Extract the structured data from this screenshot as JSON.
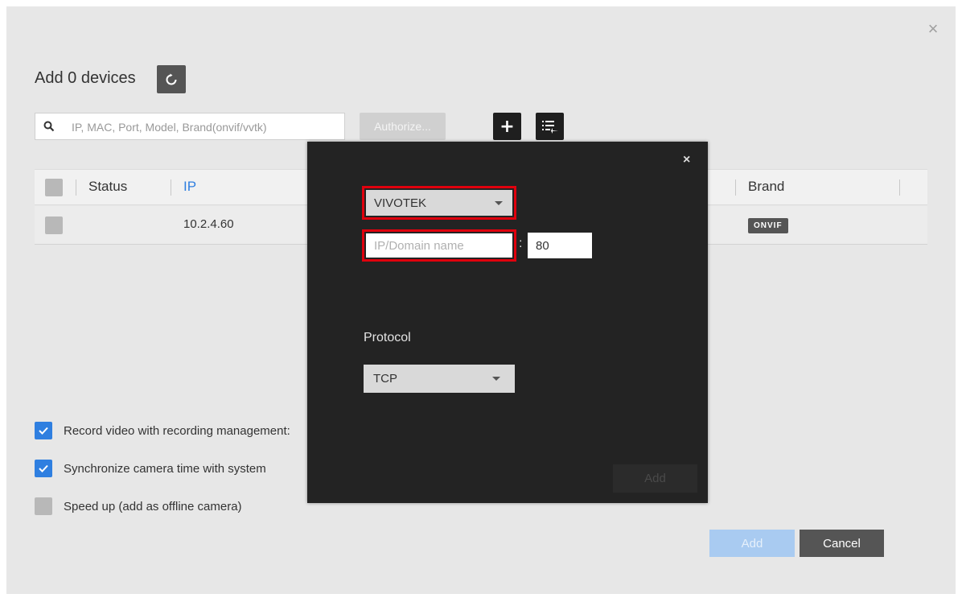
{
  "header": {
    "title": "Add 0 devices"
  },
  "search": {
    "placeholder": "IP, MAC, Port, Model, Brand(onvif/vvtk)"
  },
  "toolbar": {
    "authorize_label": "Authorize...",
    "add_label": "+"
  },
  "table": {
    "columns": [
      "Status",
      "IP",
      "Brand"
    ],
    "rows": [
      {
        "ip": "10.2.4.60",
        "brand": "ONVIF"
      }
    ]
  },
  "options": [
    {
      "label": "Record video with recording management:",
      "checked": true
    },
    {
      "label": "Synchronize camera time with system",
      "checked": true
    },
    {
      "label": "Speed up (add as offline camera)",
      "checked": false
    }
  ],
  "footer": {
    "add_label": "Add",
    "cancel_label": "Cancel"
  },
  "dialog": {
    "close_label": "×",
    "brand_value": "VIVOTEK",
    "host_placeholder": "IP/Domain name",
    "port_value": "80",
    "protocol_label": "Protocol",
    "protocol_value": "TCP",
    "add_label": "Add"
  },
  "colors": {
    "accent": "#2f7fe0",
    "highlight": "#e0000d",
    "dialog_bg": "#232323"
  }
}
